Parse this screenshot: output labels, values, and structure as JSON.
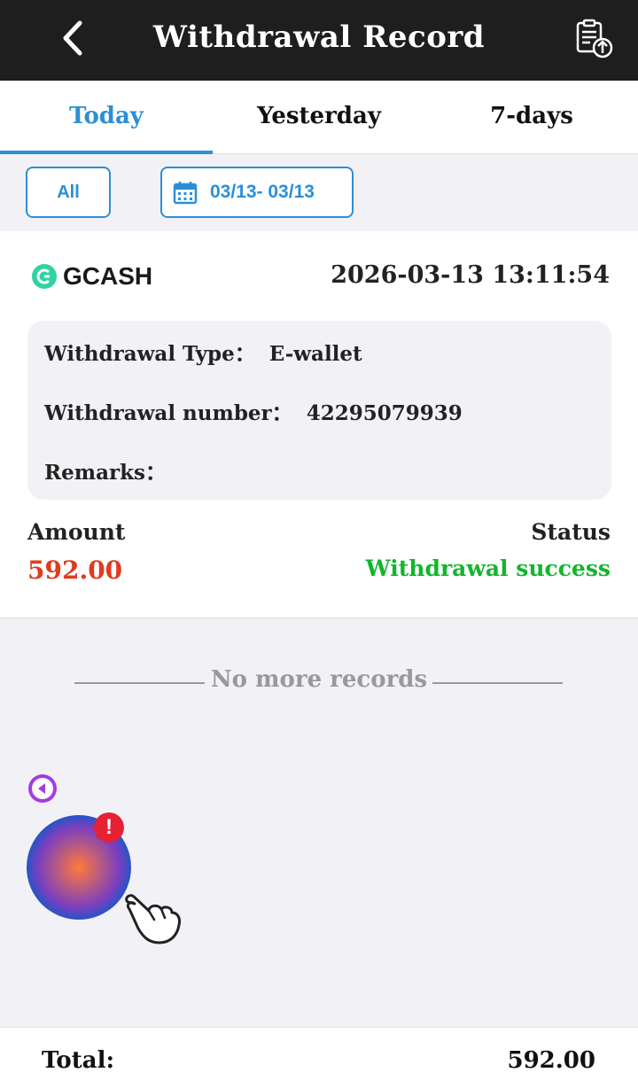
{
  "header": {
    "title": "Withdrawal Record",
    "back_icon": "chevron-left-icon",
    "upload_icon": "clipboard-upload-icon"
  },
  "tabs": [
    {
      "label": "Today",
      "active": true
    },
    {
      "label": "Yesterday",
      "active": false
    },
    {
      "label": "7-days",
      "active": false
    }
  ],
  "filter": {
    "all_label": "All",
    "date_range": "03/13- 03/13",
    "calendar_icon": "calendar-icon"
  },
  "record": {
    "method": "GCASH",
    "datetime": "2026-03-13 13:11:54",
    "type_label": "Withdrawal Type：",
    "type_value": "E-wallet",
    "number_label": "Withdrawal number：",
    "number_value": "42295079939",
    "remarks_label": "Remarks：",
    "remarks_value": "",
    "amount_label": "Amount",
    "amount_value": "592.00",
    "status_label": "Status",
    "status_value": "Withdrawal success"
  },
  "list_end": "No more records",
  "floating": {
    "badge": "!",
    "game_icon": "game-promo-icon",
    "hand_icon": "pointing-hand-icon"
  },
  "footer": {
    "total_label": "Total:",
    "total_value": "592.00"
  },
  "colors": {
    "accent": "#2b8fd6",
    "amount": "#e03b1e",
    "success": "#13b52c",
    "header_bg": "#1e1e1e"
  }
}
